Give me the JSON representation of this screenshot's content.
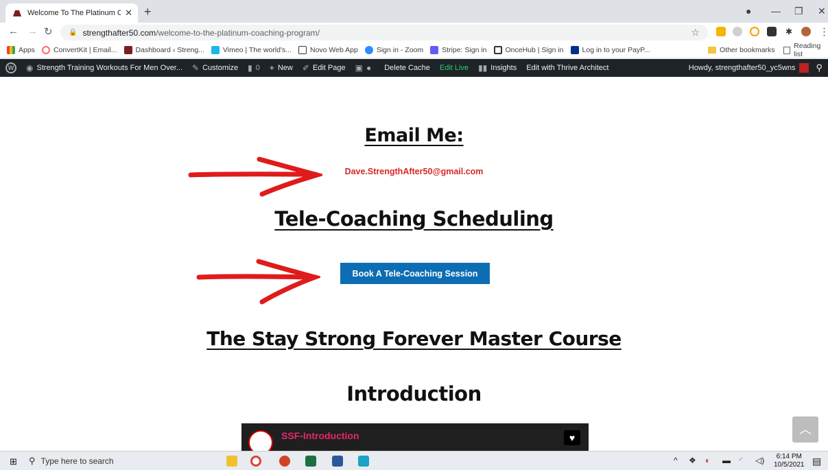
{
  "browser": {
    "tab_title": "Welcome To The Platinum Coachi",
    "url_host": "strengthafter50.com",
    "url_path": "/welcome-to-the-platinum-coaching-program/"
  },
  "bookmarks": {
    "items": [
      "Apps",
      "ConvertKit | Email...",
      "Dashboard ‹ Streng...",
      "Vimeo | The world's...",
      "Novo Web App",
      "Sign in - Zoom",
      "Stripe: Sign in",
      "OnceHub | Sign in",
      "Log in to your PayP..."
    ],
    "other": "Other bookmarks",
    "reading_list": "Reading list"
  },
  "adminbar": {
    "site": "Strength Training Workouts For Men Over...",
    "customize": "Customize",
    "comments": "0",
    "new": "New",
    "edit_page": "Edit Page",
    "delete_cache": "Delete Cache",
    "edit_live": "Edit Live",
    "insights": "Insights",
    "thrive": "Edit with Thrive Architect",
    "howdy": "Howdy, strengthafter50_yc5wns"
  },
  "content": {
    "email_heading": "Email Me:",
    "email": "Dave.StrengthAfter50@gmail.com",
    "tele_heading": "Tele-Coaching Scheduling",
    "book_button": "Book A Tele-Coaching Session",
    "course_heading": "The Stay Strong Forever Master Course",
    "intro_heading": "Introduction",
    "video_title": "SSF-Introduction"
  },
  "taskbar": {
    "search_placeholder": "Type here to search",
    "time": "6:14 PM",
    "date": "10/5/2021"
  },
  "colors": {
    "email_red": "#d62828",
    "button_blue": "#0d6db3",
    "adminbar_bg": "#1d2327",
    "arrow_red": "#e01b1b"
  }
}
